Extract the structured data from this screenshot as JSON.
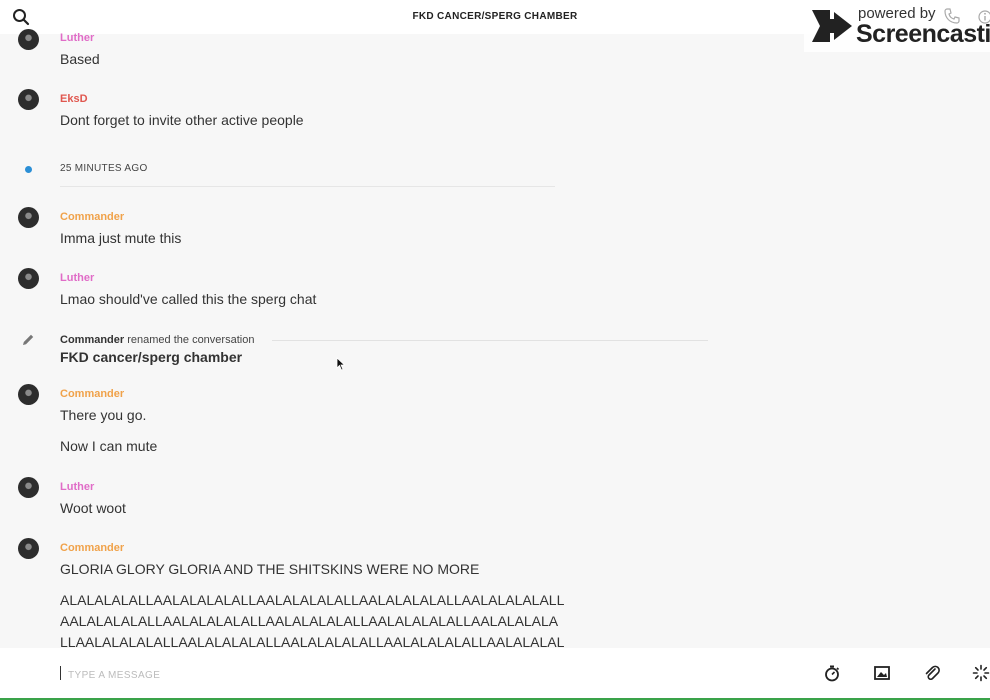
{
  "header": {
    "title": "FKD CANCER/SPERG CHAMBER"
  },
  "watermark": {
    "powered_by": "powered by",
    "brand": "Screencastify"
  },
  "messages": [
    {
      "author": "Luther",
      "text": "Based"
    },
    {
      "author": "EksD",
      "text": "Dont forget to invite other active people"
    },
    {
      "author": "Commander",
      "text": "Imma just mute this"
    },
    {
      "author": "Luther",
      "text": "Lmao should've called this the sperg chat"
    },
    {
      "author": "Commander",
      "text": "There you go.",
      "text2": "Now I can mute"
    },
    {
      "author": "Luther",
      "text": "Woot woot"
    },
    {
      "author": "Commander",
      "text": "GLORIA GLORY GLORIA AND THE SHITSKINS WERE NO MORE",
      "lines": [
        "ALALALALALLAALALALALALLAALALALALALLAALALALALALLAALALALALALL",
        "AALALALALALLAALALALALALLAALALALALALLAALALALALALLAALALALALA",
        "LLAALALALALALLAALALALALALLAALALALALALLAALALALALALLAALALALAL"
      ]
    }
  ],
  "time_divider": {
    "label": "25 MINUTES AGO"
  },
  "rename": {
    "actor": "Commander",
    "action": "renamed the conversation",
    "new_name": "FKD cancer/sperg chamber"
  },
  "composer": {
    "placeholder": "TYPE A MESSAGE"
  },
  "colors": {
    "luther": "#e06cc7",
    "eksd": "#e0574f",
    "commander": "#f0a24a",
    "divider_dot": "#2b8fd6",
    "accent_bar": "#3aa34a"
  },
  "icons": [
    "search-icon",
    "pencil-icon",
    "timer-icon",
    "image-icon",
    "paperclip-icon",
    "sparkle-icon",
    "phone-icon",
    "info-icon"
  ]
}
